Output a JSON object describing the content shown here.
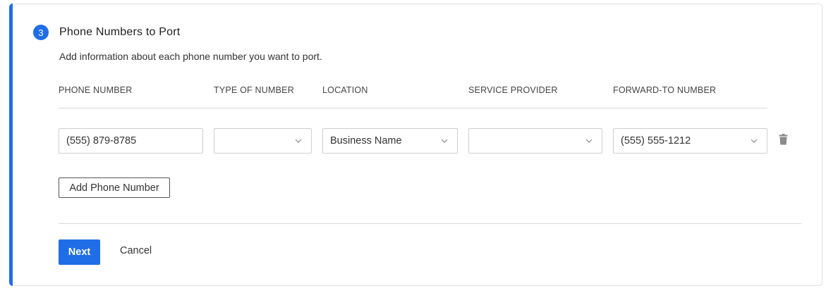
{
  "section": {
    "step_number": "3",
    "title": "Phone Numbers to Port",
    "description": "Add information about each phone number you want to port.",
    "accent_color": "#1f6ee8"
  },
  "table": {
    "headers": [
      "PHONE NUMBER",
      "TYPE OF NUMBER",
      "LOCATION",
      "SERVICE PROVIDER",
      "FORWARD-TO NUMBER"
    ],
    "rows": [
      {
        "phone_number": "(555) 879-8785",
        "type_of_number": "",
        "location": "Business Name",
        "service_provider": "",
        "forward_to_number": "(555) 555-1212",
        "delete_icon": "trash-icon"
      }
    ]
  },
  "actions": {
    "add_phone_number": "Add Phone Number",
    "next": "Next",
    "cancel": "Cancel"
  },
  "icons": {
    "dropdown": "chevron-down-icon",
    "delete": "trash-icon"
  }
}
